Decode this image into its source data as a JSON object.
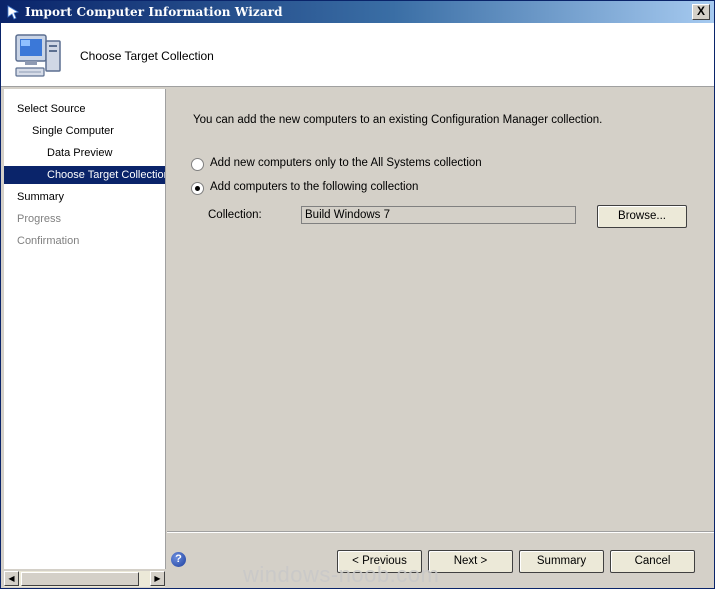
{
  "window": {
    "title": "Import Computer Information Wizard",
    "close_label": "X"
  },
  "header": {
    "title": "Choose Target Collection",
    "icon": "computer-icon"
  },
  "nav": {
    "items": [
      {
        "label": "Select Source",
        "state": "normal"
      },
      {
        "label": "Single Computer",
        "state": "normal"
      },
      {
        "label": "Data Preview",
        "state": "normal"
      },
      {
        "label": "Choose Target Collection",
        "state": "selected"
      },
      {
        "label": "Summary",
        "state": "normal"
      },
      {
        "label": "Progress",
        "state": "disabled"
      },
      {
        "label": "Confirmation",
        "state": "disabled"
      }
    ]
  },
  "content": {
    "intro": "You can add the new computers to an existing Configuration Manager collection.",
    "options": [
      {
        "label": "Add new computers only to the All Systems collection",
        "checked": false
      },
      {
        "label": "Add computers to the following collection",
        "checked": true
      }
    ],
    "collection_label": "Collection:",
    "collection_value": "Build Windows 7",
    "browse_label": "Browse..."
  },
  "footer": {
    "help_icon": "question-icon",
    "help_glyph": "?",
    "previous_label": "< Previous",
    "next_label": "Next >",
    "summary_label": "Summary",
    "cancel_label": "Cancel"
  },
  "watermark": "windows-noob.com",
  "colors": {
    "titlebar": "#0a246a",
    "selection": "#0a246a",
    "dialog": "#d4d0c8"
  }
}
